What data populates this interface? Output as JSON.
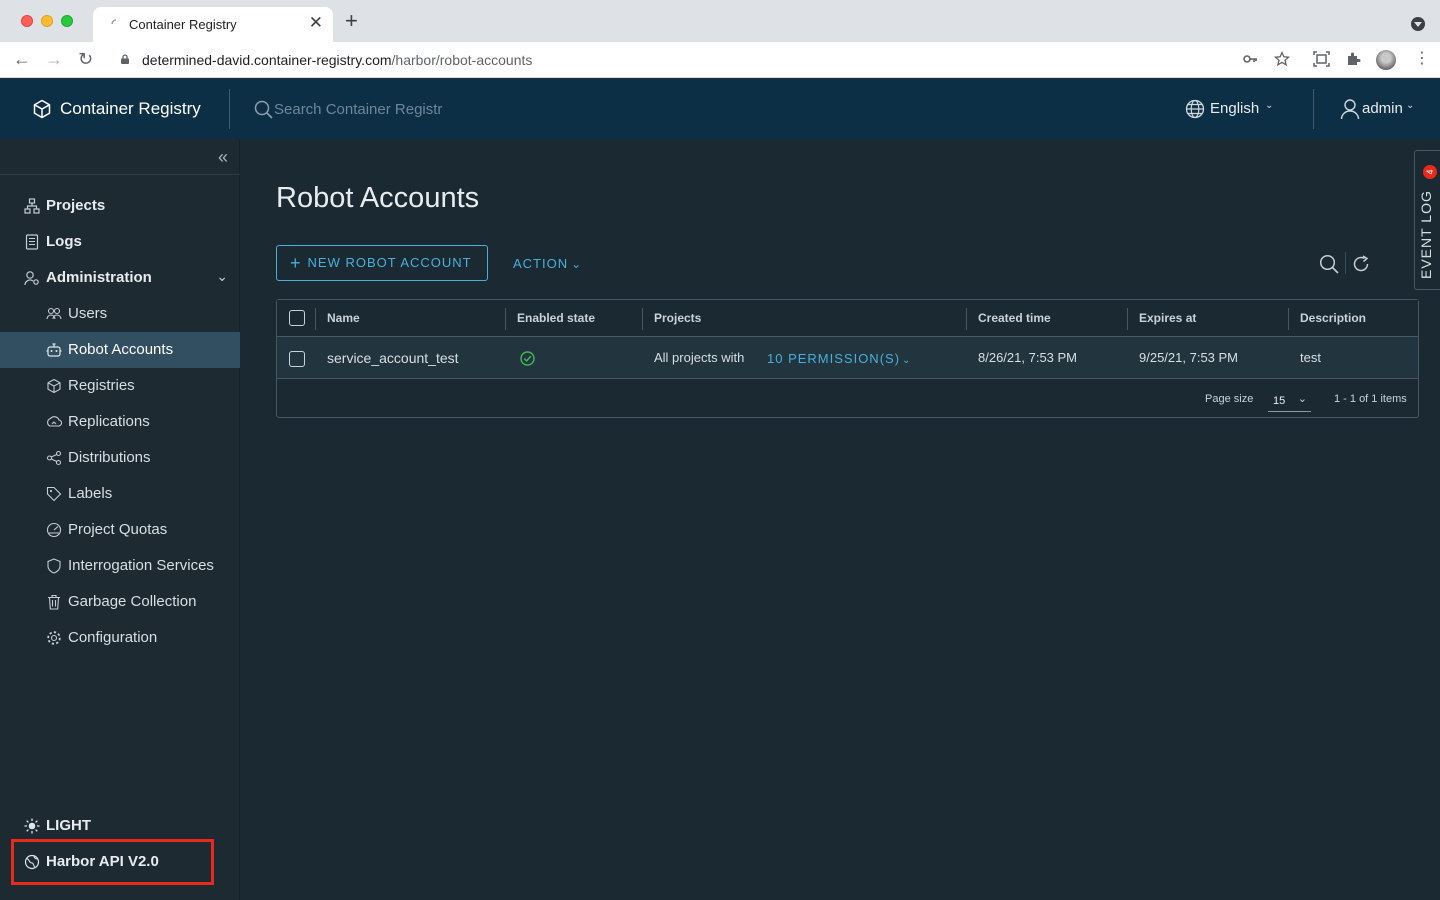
{
  "browser": {
    "tab_title": "Container Registry",
    "tab_close": "✕",
    "new_tab": "+",
    "url_host": "determined-david.container-registry.com",
    "url_path": "/harbor/robot-accounts"
  },
  "header": {
    "brand": "Container Registry",
    "search_placeholder": "Search Container Registr",
    "language": "English",
    "user": "admin"
  },
  "sidebar": {
    "items": [
      {
        "label": "Projects",
        "icon": "projects-icon"
      },
      {
        "label": "Logs",
        "icon": "logs-icon"
      },
      {
        "label": "Administration",
        "icon": "administration-icon"
      },
      {
        "label": "Users",
        "icon": "users-icon"
      },
      {
        "label": "Robot Accounts",
        "icon": "robot-icon"
      },
      {
        "label": "Registries",
        "icon": "registries-icon"
      },
      {
        "label": "Replications",
        "icon": "replications-icon"
      },
      {
        "label": "Distributions",
        "icon": "distributions-icon"
      },
      {
        "label": "Labels",
        "icon": "labels-icon"
      },
      {
        "label": "Project Quotas",
        "icon": "quotas-icon"
      },
      {
        "label": "Interrogation Services",
        "icon": "shield-icon"
      },
      {
        "label": "Garbage Collection",
        "icon": "trash-icon"
      },
      {
        "label": "Configuration",
        "icon": "gear-icon"
      }
    ],
    "theme_toggle": "LIGHT",
    "api_link": "Harbor API V2.0"
  },
  "main": {
    "title": "Robot Accounts",
    "new_button": "NEW ROBOT ACCOUNT",
    "action_button": "ACTION",
    "columns": [
      "Name",
      "Enabled state",
      "Projects",
      "Created time",
      "Expires at",
      "Description"
    ],
    "rows": [
      {
        "name": "service_account_test",
        "projects_prefix": "All projects with",
        "permissions": "10 PERMISSION(S)",
        "created": "8/26/21, 7:53 PM",
        "expires": "9/25/21, 7:53 PM",
        "description": "test"
      }
    ],
    "page_size_label": "Page size",
    "page_size": "15",
    "items_count": "1 - 1 of 1 items"
  },
  "event_log": {
    "label": "EVENT LOG",
    "badge": "4"
  },
  "colors": {
    "accent": "#49afd9",
    "header_bg": "#0d2f45",
    "highlight": "#e8291c",
    "success": "#3fb950"
  }
}
